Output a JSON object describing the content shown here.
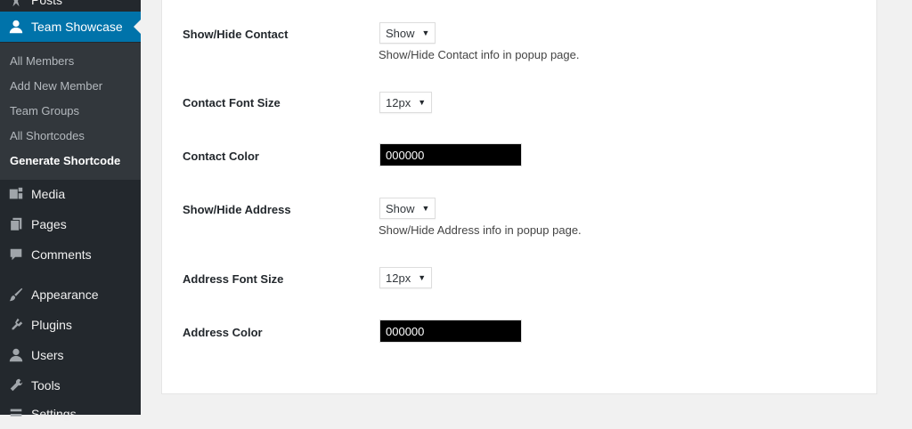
{
  "sidebar": {
    "items": [
      {
        "label": "Posts",
        "icon": "pin-icon"
      },
      {
        "label": "Team Showcase",
        "icon": "user-icon",
        "active": true
      },
      {
        "label": "Media",
        "icon": "media-icon"
      },
      {
        "label": "Pages",
        "icon": "pages-icon"
      },
      {
        "label": "Comments",
        "icon": "comment-icon"
      },
      {
        "label": "Appearance",
        "icon": "brush-icon"
      },
      {
        "label": "Plugins",
        "icon": "plugin-icon"
      },
      {
        "label": "Users",
        "icon": "users-icon"
      },
      {
        "label": "Tools",
        "icon": "wrench-icon"
      },
      {
        "label": "Settings",
        "icon": "settings-icon"
      }
    ],
    "submenu": [
      {
        "label": "All Members"
      },
      {
        "label": "Add New Member"
      },
      {
        "label": "Team Groups"
      },
      {
        "label": "All Shortcodes"
      },
      {
        "label": "Generate Shortcode",
        "current": true
      }
    ]
  },
  "settings": {
    "show_hide_contact": {
      "label": "Show/Hide Contact",
      "value": "Show",
      "help": "Show/Hide Contact info in popup page."
    },
    "contact_font_size": {
      "label": "Contact Font Size",
      "value": "12px"
    },
    "contact_color": {
      "label": "Contact Color",
      "value": "000000"
    },
    "show_hide_address": {
      "label": "Show/Hide Address",
      "value": "Show",
      "help": "Show/Hide Address info in popup page."
    },
    "address_font_size": {
      "label": "Address Font Size",
      "value": "12px"
    },
    "address_color": {
      "label": "Address Color",
      "value": "000000"
    }
  },
  "colors": {
    "sidebar_bg": "#23282d",
    "submenu_bg": "#32373c",
    "accent": "#0073aa",
    "swatch": "#000000"
  }
}
